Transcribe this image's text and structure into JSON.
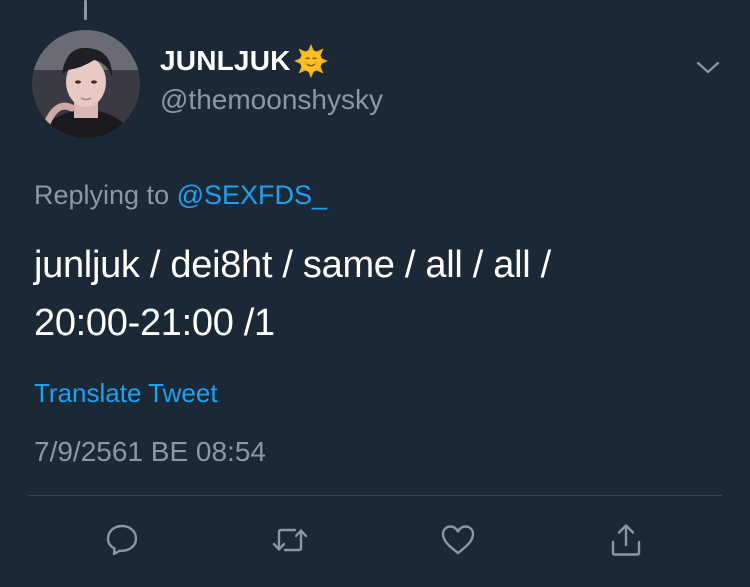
{
  "tweet": {
    "author": {
      "display_name": "JUNLJUK",
      "name_emoji": "sun-with-face-emoji",
      "handle": "@themoonshysky"
    },
    "replying_prefix": "Replying to",
    "replying_to": "@SEXFDS_",
    "text_line1": "junljuk / dei8ht / same / all / all /",
    "text_line2": "20:00-21:00 /1",
    "translate_label": "Translate Tweet",
    "timestamp": "7/9/2561 BE 08:54"
  },
  "actions": [
    {
      "name": "reply",
      "icon": "speech-bubble-icon"
    },
    {
      "name": "retweet",
      "icon": "retweet-arrows-icon"
    },
    {
      "name": "like",
      "icon": "heart-icon"
    },
    {
      "name": "share",
      "icon": "share-upload-icon"
    }
  ],
  "colors": {
    "background": "#1b2836",
    "primary_text": "#ffffff",
    "secondary_text": "#8899a6",
    "accent": "#1da1f2",
    "divider": "#38444d"
  }
}
